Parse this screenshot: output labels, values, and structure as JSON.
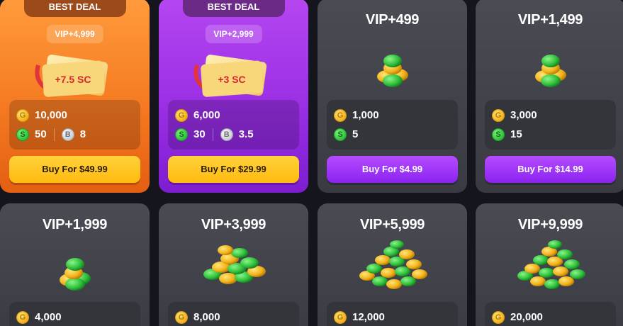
{
  "cards": [
    {
      "badge": "BEST DEAL",
      "vip": "VIP+4,999",
      "ticket": "+7.5 SC",
      "gold": "10,000",
      "sweeps": "50",
      "bonus": "8",
      "buy": "Buy For $49.99"
    },
    {
      "badge": "BEST DEAL",
      "vip": "VIP+2,999",
      "ticket": "+3 SC",
      "gold": "6,000",
      "sweeps": "30",
      "bonus": "3.5",
      "buy": "Buy For $29.99"
    },
    {
      "vip": "VIP+499",
      "gold": "1,000",
      "sweeps": "5",
      "buy": "Buy For $4.99"
    },
    {
      "vip": "VIP+1,499",
      "gold": "3,000",
      "sweeps": "15",
      "buy": "Buy For $14.99"
    },
    {
      "vip": "VIP+1,999",
      "gold": "4,000"
    },
    {
      "vip": "VIP+3,999",
      "gold": "8,000"
    },
    {
      "vip": "VIP+5,999",
      "gold": "12,000"
    },
    {
      "vip": "VIP+9,999",
      "gold": "20,000"
    }
  ],
  "icons": {
    "gold": "gold-coin-icon",
    "sweeps": "sweeps-coin-icon",
    "bonus": "silver-coin-icon"
  },
  "colors": {
    "orange": "#f57a22",
    "purple": "#9a2fe4",
    "card": "#3f4047",
    "gold_button": "#ffc21e",
    "violet_button": "#9a2ff2"
  }
}
